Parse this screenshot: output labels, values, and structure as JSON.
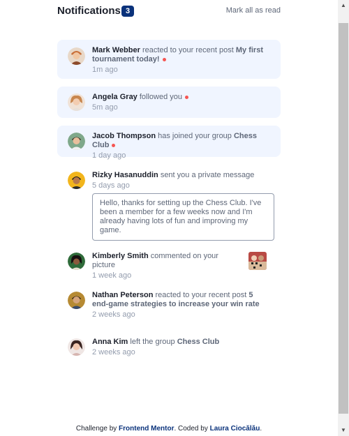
{
  "header": {
    "title": "Notifications",
    "count": "3",
    "mark_all": "Mark all as read"
  },
  "notifications": [
    {
      "name": "Mark Webber",
      "action": "reacted to your recent post",
      "target": "My first tournament today!",
      "time": "1m ago",
      "unread": true,
      "avatar": "avatar-mark"
    },
    {
      "name": "Angela Gray",
      "action": "followed you",
      "time": "5m ago",
      "unread": true,
      "avatar": "avatar-angela"
    },
    {
      "name": "Jacob Thompson",
      "action": "has joined your group",
      "target": "Chess Club",
      "time": "1 day ago",
      "unread": true,
      "avatar": "avatar-jacob"
    },
    {
      "name": "Rizky Hasanuddin",
      "action": "sent you a private message",
      "time": "5 days ago",
      "unread": false,
      "avatar": "avatar-rizky",
      "message": "Hello, thanks for setting up the Chess Club. I've been a member for a few weeks now and I'm already having lots of fun and improving my game."
    },
    {
      "name": "Kimberly Smith",
      "action": "commented on your picture",
      "time": "1 week ago",
      "unread": false,
      "avatar": "avatar-kimberly",
      "picture": "chess-picture"
    },
    {
      "name": "Nathan Peterson",
      "action": "reacted to your recent post",
      "target": "5 end-game strategies to increase your win rate",
      "time": "2 weeks ago",
      "unread": false,
      "avatar": "avatar-nathan"
    },
    {
      "name": "Anna Kim",
      "action": "left the group",
      "target": "Chess Club",
      "time": "2 weeks ago",
      "unread": false,
      "avatar": "avatar-anna"
    }
  ],
  "footer": {
    "prefix": "Challenge by",
    "link1": "Frontend Mentor",
    "middle": ". Coded by",
    "link2": "Laura Ciocălău",
    "suffix": "."
  },
  "colors": {
    "accent": "#0a327b",
    "unread_bg": "#f0f5ff",
    "dot": "#f65552"
  }
}
